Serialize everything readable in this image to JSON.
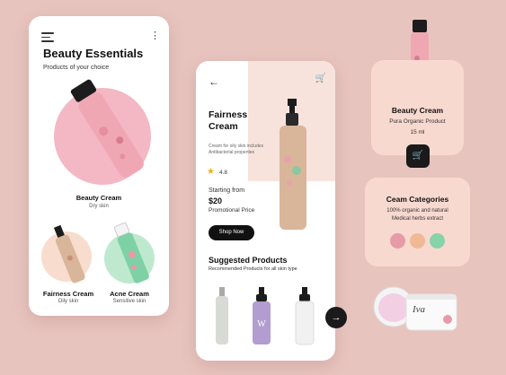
{
  "home": {
    "title": "Beauty Essentials",
    "subtitle": "Products of your choice",
    "featured": {
      "name": "Beauty Cream",
      "type": "Dry skin"
    },
    "products": [
      {
        "name": "Fairness Cream",
        "type": "Oily skin"
      },
      {
        "name": "Acne Cream",
        "type": "Sensitive skin"
      }
    ],
    "menu_icon": "hamburger-menu-icon",
    "more_icon": "vertical-dots-icon",
    "more_glyph": "⋮"
  },
  "detail": {
    "back_glyph": "←",
    "cart_glyph": "🛒",
    "name": "Fairness Cream",
    "description": "Cream for oily skin includes Antibacterial properties",
    "star_glyph": "★",
    "rating": "4.8",
    "price_prefix": "Starting from",
    "price": "$20",
    "price_note": "Promotional Price",
    "shop_label": "Shop Now",
    "suggested_title": "Suggested Products",
    "suggested_sub": "Recommended Products for all skin type",
    "next_glyph": "→"
  },
  "info_card": {
    "name": "Beauty Cream",
    "desc": "Pura Organic Product",
    "size": "15 ml",
    "cart_glyph": "🛒"
  },
  "categories": {
    "title": "Ceam Categories",
    "line1": "100% organic and natural",
    "line2": "Medical herbs extract",
    "colors": [
      "#e79aa8",
      "#f0b996",
      "#86d3aa"
    ]
  },
  "jar_label": "Iva",
  "colors": {
    "background": "#e8c4bf",
    "accent_pink": "#f3b8c4",
    "accent_peach": "#f8e3dc",
    "accent_green": "#bfe9cf",
    "dark": "#1a1a1a"
  }
}
